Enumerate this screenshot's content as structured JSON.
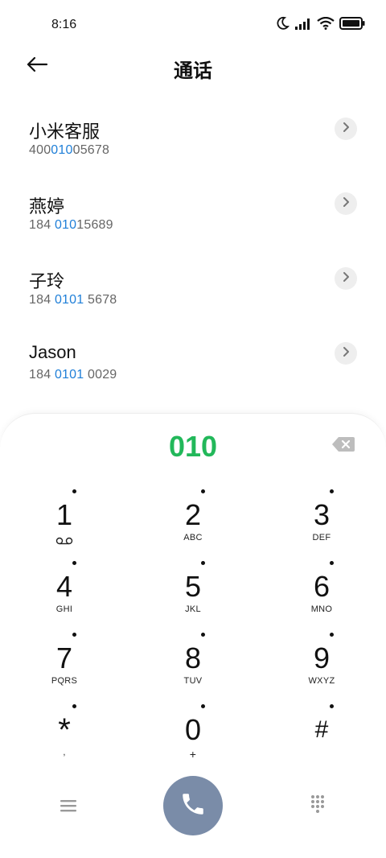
{
  "status_bar": {
    "time": "8:16",
    "icons": [
      "moon-icon",
      "signal-icon",
      "wifi-icon",
      "battery-icon"
    ]
  },
  "header": {
    "title": "通话",
    "back_icon": "arrow-left-icon"
  },
  "contacts": [
    {
      "name": "小米客服",
      "number_pre": "400",
      "number_match": "010",
      "number_post": "05678"
    },
    {
      "name": "燕婷",
      "number_pre": "184 ",
      "number_match": "010",
      "number_post": "15689"
    },
    {
      "name": "子玲",
      "number_pre": "184 ",
      "number_match": "0101",
      "number_post": " 5678"
    },
    {
      "name": "Jason",
      "number_pre": "184 ",
      "number_match": "0101",
      "number_post": " 0029"
    }
  ],
  "dialpad": {
    "input_value": "010",
    "keys": [
      {
        "digit": "1",
        "letters": ""
      },
      {
        "digit": "2",
        "letters": "ABC"
      },
      {
        "digit": "3",
        "letters": "DEF"
      },
      {
        "digit": "4",
        "letters": "GHI"
      },
      {
        "digit": "5",
        "letters": "JKL"
      },
      {
        "digit": "6",
        "letters": "MNO"
      },
      {
        "digit": "7",
        "letters": "PQRS"
      },
      {
        "digit": "8",
        "letters": "TUV"
      },
      {
        "digit": "9",
        "letters": "WXYZ"
      },
      {
        "digit": "*",
        "letters": ","
      },
      {
        "digit": "0",
        "letters": "+"
      },
      {
        "digit": "#",
        "letters": ""
      }
    ]
  },
  "colors": {
    "match_highlight": "#1f7fd8",
    "input_text": "#22b85a",
    "call_button": "#7a8ca8"
  }
}
